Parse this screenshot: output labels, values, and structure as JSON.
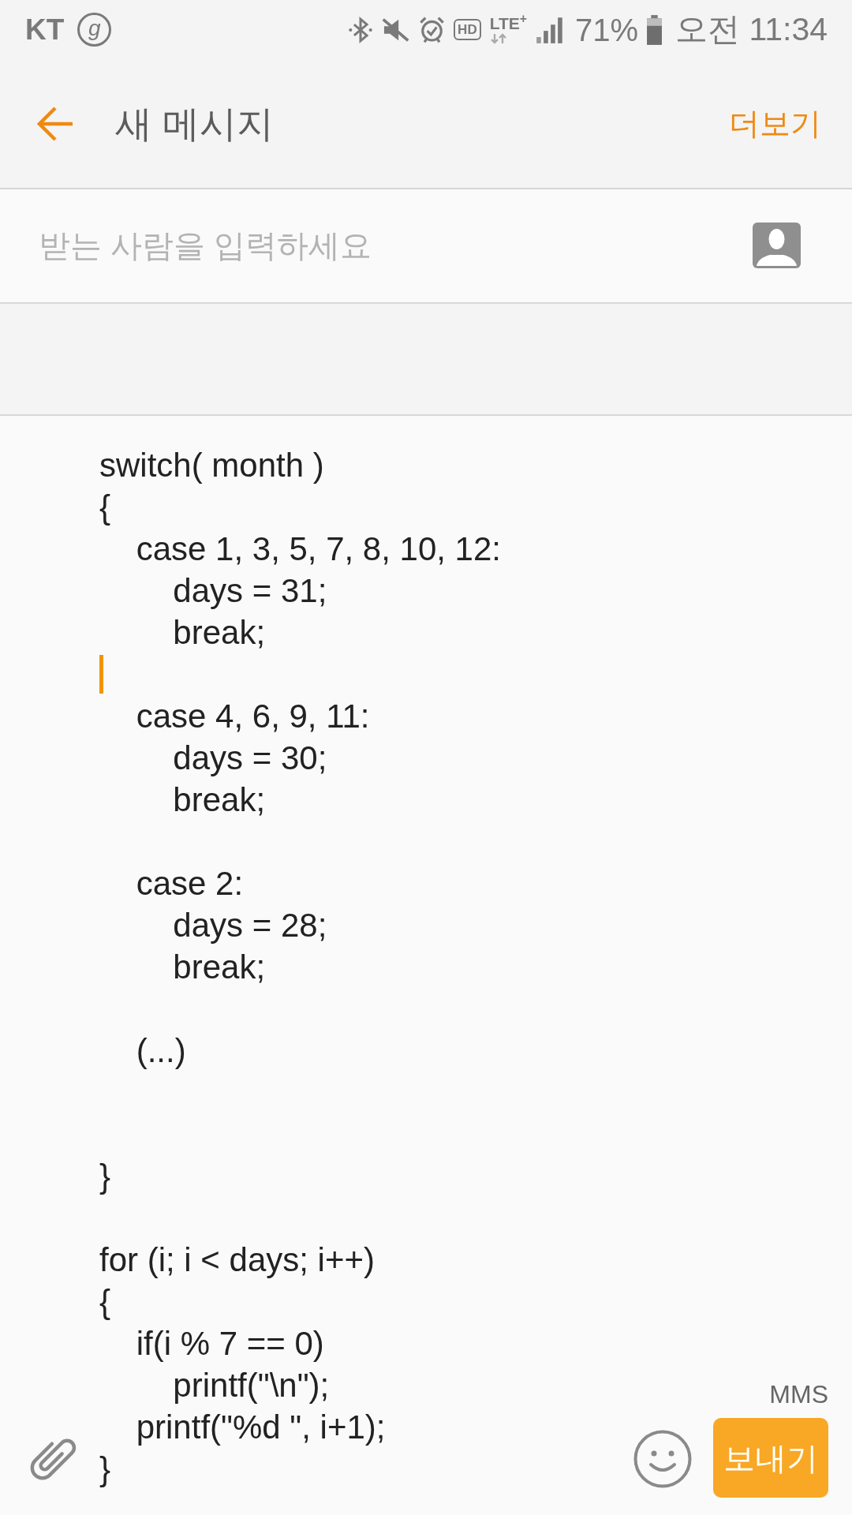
{
  "status_bar": {
    "carrier": "KT",
    "badge": "g",
    "icons": [
      {
        "kind": "bluetooth"
      },
      {
        "kind": "mute"
      },
      {
        "kind": "alarm"
      },
      {
        "kind": "hd",
        "label": "HD"
      },
      {
        "kind": "lte",
        "label": "LTE$^{+}$"
      },
      {
        "kind": "signal"
      }
    ],
    "battery_percent": "71%",
    "time": "오전 11:34"
  },
  "app_bar": {
    "title": "새 메시지",
    "more": "더보기"
  },
  "recipient": {
    "placeholder": "받는 사람을 입력하세요"
  },
  "message": {
    "lines": [
      {
        "text": "switch( month )",
        "caret": false
      },
      {
        "text": "{",
        "caret": false
      },
      {
        "text": "    case 1, 3, 5, 7, 8, 10, 12:",
        "caret": false
      },
      {
        "text": "        days = 31;",
        "caret": false
      },
      {
        "text": "        break;",
        "caret": false
      },
      {
        "caret": true
      },
      {
        "text": "    case 4, 6, 9, 11:",
        "caret": false
      },
      {
        "text": "        days = 30;",
        "caret": false
      },
      {
        "text": "        break;",
        "caret": false
      },
      {
        "caret": false
      },
      {
        "text": "    case 2:",
        "caret": false
      },
      {
        "text": "        days = 28;",
        "caret": false
      },
      {
        "text": "        break;",
        "caret": false
      },
      {
        "caret": false
      },
      {
        "text": "    (...)",
        "caret": false
      },
      {
        "caret": false
      },
      {
        "caret": false
      },
      {
        "text": "}",
        "caret": false
      },
      {
        "caret": false
      },
      {
        "text": "for (i; i < days; i++)",
        "caret": false
      },
      {
        "text": "{",
        "caret": false
      },
      {
        "text": "    if(i % 7 == 0)",
        "caret": false
      },
      {
        "text": "        printf(\"\\n\");",
        "caret": false
      },
      {
        "text": "    printf(\"%d \", i+1);",
        "caret": false
      },
      {
        "text": "}",
        "caret": false
      }
    ]
  },
  "composer": {
    "type_label": "MMS",
    "send": "보내기"
  }
}
